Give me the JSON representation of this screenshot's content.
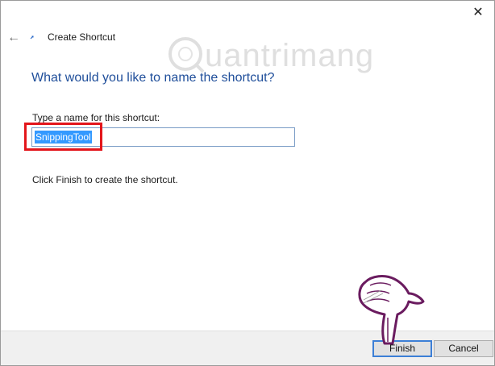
{
  "window": {
    "close_symbol": "✕",
    "back_symbol": "←",
    "title": "Create Shortcut"
  },
  "watermark": {
    "text": "uantrimang"
  },
  "main": {
    "heading": "What would you like to name the shortcut?",
    "field_label": "Type a name for this shortcut:",
    "field_value": "SnippingTool",
    "finish_note": "Click Finish to create the shortcut."
  },
  "footer": {
    "finish_label": "Finish",
    "cancel_label": "Cancel"
  },
  "colors": {
    "heading": "#1f4e9a",
    "selection": "#3399ff",
    "highlight": "#e3161b",
    "pointer_outline": "#6a1b5f"
  }
}
